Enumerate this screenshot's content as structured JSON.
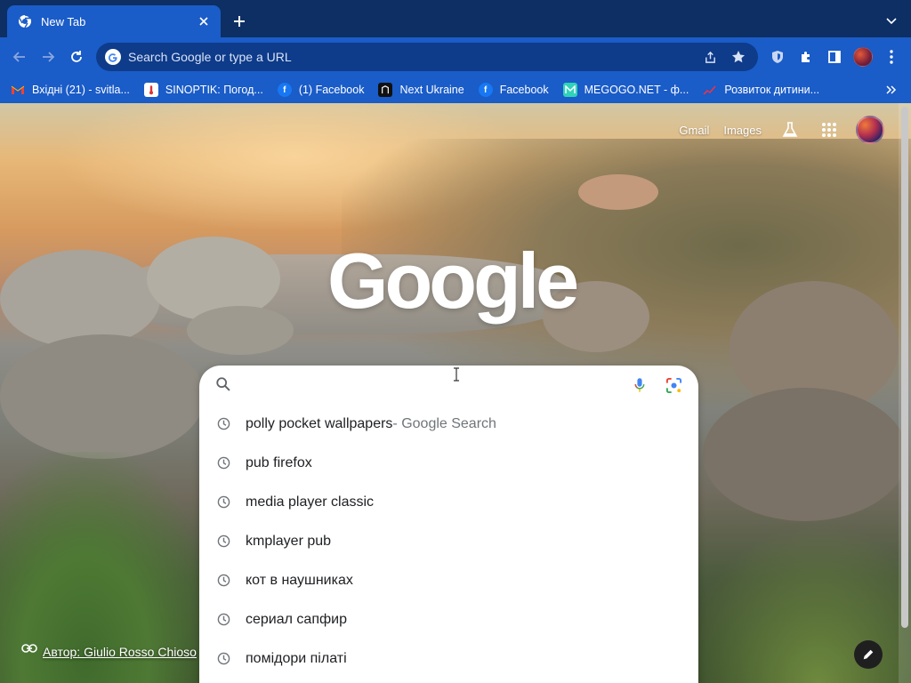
{
  "browser": {
    "tab": {
      "title": "New Tab",
      "favicon": "chrome-icon",
      "close_icon": "close-icon"
    },
    "new_tab_icon": "plus-icon",
    "tab_search_icon": "chevron-down-icon",
    "toolbar": {
      "back_icon": "arrow-left-icon",
      "forward_icon": "arrow-right-icon",
      "reload_icon": "reload-icon",
      "omnibox_placeholder": "Search Google or type a URL",
      "share_icon": "share-icon",
      "bookmark_icon": "star-icon",
      "extensions": [
        "shield-icon",
        "puzzle-icon",
        "sidepanel-icon",
        "profile-avatar",
        "kebab-menu-icon"
      ]
    },
    "bookmarks": [
      {
        "label": "Вхідні (21) - svitla...",
        "icon": "gmail-icon"
      },
      {
        "label": "SINOPTIK: Погод...",
        "icon": "thermometer-icon"
      },
      {
        "label": "(1) Facebook",
        "icon": "facebook-icon"
      },
      {
        "label": "Next Ukraine",
        "icon": "dark-square-icon"
      },
      {
        "label": "Facebook",
        "icon": "facebook-icon"
      },
      {
        "label": "MEGOGO.NET - ф...",
        "icon": "megogo-icon"
      },
      {
        "label": "Розвиток дитини...",
        "icon": "chart-icon"
      }
    ],
    "bookmarks_more_icon": "double-chevron-icon"
  },
  "newtab": {
    "links": {
      "gmail": "Gmail",
      "images": "Images"
    },
    "labs_icon": "flask-icon",
    "apps_icon": "apps-grid-icon",
    "logo_text": "Google",
    "search": {
      "placeholder": "",
      "value": "",
      "mic_icon": "microphone-icon",
      "lens_icon": "lens-icon"
    },
    "suggestions": [
      {
        "text": "polly pocket wallpapers",
        "suffix": " - Google Search"
      },
      {
        "text": "pub firefox",
        "suffix": ""
      },
      {
        "text": "media player classic",
        "suffix": ""
      },
      {
        "text": "kmplayer pub",
        "suffix": ""
      },
      {
        "text": "кот в наушниках",
        "suffix": ""
      },
      {
        "text": "сериал сапфир",
        "suffix": ""
      },
      {
        "text": "помідори пілаті",
        "suffix": ""
      }
    ],
    "attribution": "Автор: Giulio Rosso Chioso",
    "customize_icon": "pencil-icon"
  },
  "colors": {
    "tabstrip": "#0d2f63",
    "toolbar": "#1a5cc8",
    "omnibox": "#0e3b8a"
  }
}
